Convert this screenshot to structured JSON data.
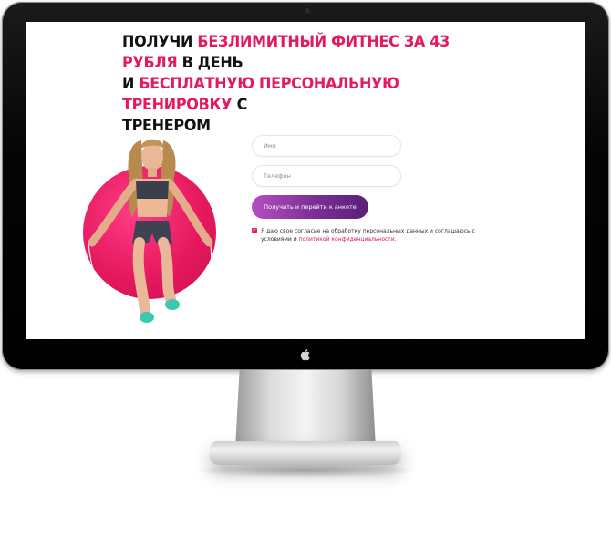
{
  "headline": {
    "part1": "Получи ",
    "accent1": "безлимитный фитнес за 43 рубля",
    "part2": " в день",
    "part3": "и ",
    "accent2": "бесплатную персональную тренировку",
    "part4": " с",
    "part5": "тренером"
  },
  "form": {
    "name_placeholder": "Имя",
    "phone_placeholder": "Телефон",
    "submit_label": "Получить и перейти к анкете",
    "consent_text": "Я даю свое согласие на обработку персональных данных и соглашаюсь с условиями и ",
    "consent_link": "политикой конфиденциальности",
    "consent_end": ".",
    "consent_checked": true
  },
  "colors": {
    "accent": "#e6195e",
    "button_start": "#b44fbf",
    "button_end": "#5a2078"
  },
  "icons": {
    "chin_logo": "apple-logo-icon",
    "checkbox": "checkmark-icon"
  }
}
